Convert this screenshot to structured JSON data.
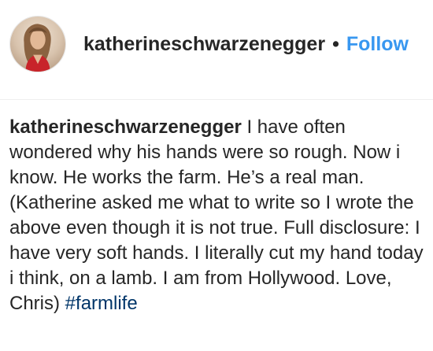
{
  "post": {
    "author": {
      "username": "katherineschwarzenegger",
      "separator": "•",
      "follow_label": "Follow",
      "avatar_icon": "profile-photo-icon"
    },
    "caption": {
      "username": "katherineschwarzenegger",
      "text": "I have often wondered why his hands were so rough. Now i know. He works the farm. He’s a real man. (Katherine asked me what to write so I wrote the above even though it is not true. Full disclosure: I have very soft hands. I literally cut my hand today i think, on a lamb. I am from Hollywood. Love, Chris)",
      "hashtag": "#farmlife"
    }
  },
  "colors": {
    "text": "#262626",
    "follow": "#3897f0",
    "hashtag": "#003569",
    "divider": "#efefef"
  }
}
